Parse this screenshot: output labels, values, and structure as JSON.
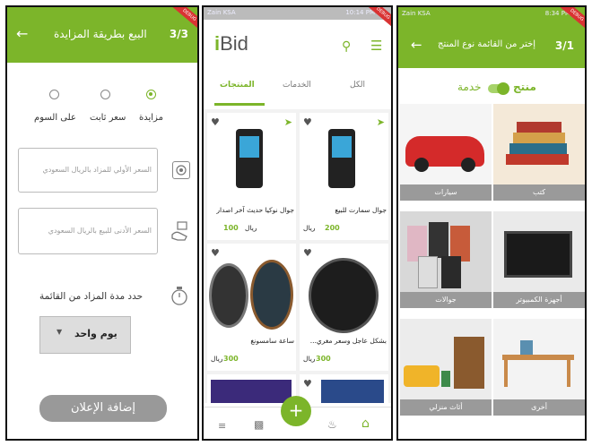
{
  "colors": {
    "accent": "#7cb52a",
    "debug": "#d93333"
  },
  "screen1": {
    "title": "البيع بطريقة المزايدة",
    "step": "3/3",
    "debug": "DEBUG",
    "options": [
      "مزايدة",
      "سعر ثابت",
      "على السوم"
    ],
    "selected": "مزايدة",
    "field1_placeholder": "السعر الأولي للمزاد بالريال السعودي",
    "field2_placeholder": "السعر الأدنى للبيع بالريال السعودي",
    "duration_label": "حدد مدة المزاد من القائمة",
    "duration_value": "يوم واحد",
    "submit": "إضافة الإعلان"
  },
  "screen2": {
    "status": "Zain KSA",
    "status_right": "10:14 PM",
    "logo_i": "i",
    "logo_rest": "Bid",
    "tabs": [
      "المنتجات",
      "الخدمات",
      "الكل"
    ],
    "products": [
      {
        "title": "جوال سمارت للبيع",
        "price": "200",
        "currency": "ريال"
      },
      {
        "title": "جوال نوكيا حديث آخر اصدار",
        "price": "100",
        "currency": "ريال"
      },
      {
        "title": "بشكل عاجل وسعر مغري...",
        "price": "300",
        "currency": "ريال"
      },
      {
        "title": "ساعة سامسونغ",
        "price": "300",
        "currency": "ريال"
      }
    ],
    "fab": "+"
  },
  "screen3": {
    "status": "Zain KSA",
    "status_right": "8:34 PM",
    "title": "إختر من القائمة نوع المنتج",
    "step": "3/1",
    "toggle_product": "منتج",
    "toggle_service": "خدمة",
    "categories": [
      "كتب",
      "سيارات",
      "أجهزة الكمبيوتر",
      "جوالات",
      "أخرى",
      "أثاث منزلي"
    ]
  }
}
